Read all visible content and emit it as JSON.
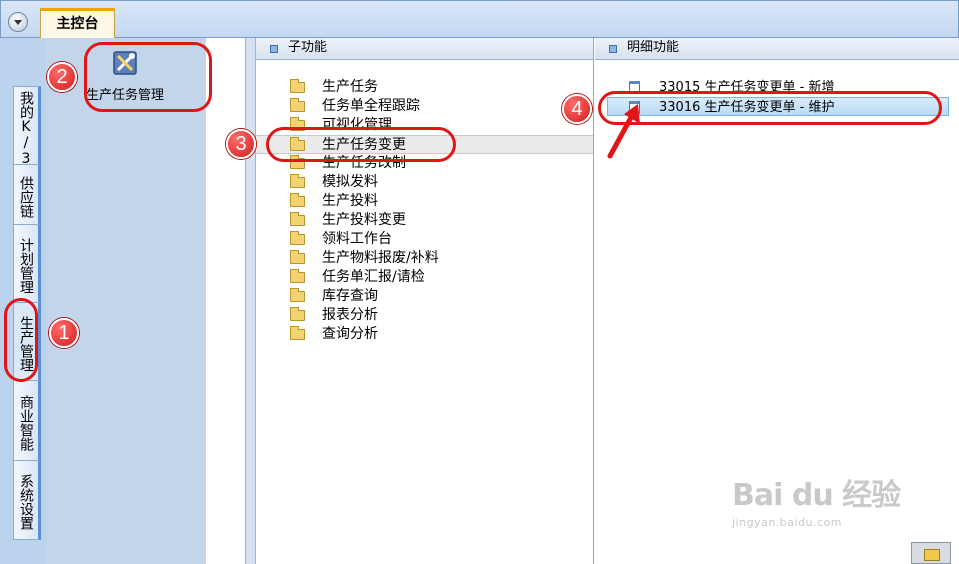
{
  "top_tab": {
    "label": "主控台"
  },
  "left_nav": {
    "tabs": [
      {
        "label": "我的K/3"
      },
      {
        "label": "供应链"
      },
      {
        "label": "计划管理"
      },
      {
        "label": "生产管理",
        "active": true
      },
      {
        "label": "商业智能"
      },
      {
        "label": "系统设置"
      }
    ]
  },
  "module": {
    "label": "生产任务管理"
  },
  "sub_panel": {
    "header": "子功能",
    "items": [
      "生产任务",
      "任务单全程跟踪",
      "可视化管理",
      "生产任务变更",
      "生产任务改制",
      "模拟发料",
      "生产投料",
      "生产投料变更",
      "领料工作台",
      "生产物料报废/补料",
      "任务单汇报/请检",
      "库存查询",
      "报表分析",
      "查询分析"
    ],
    "selected_index": 3
  },
  "detail_panel": {
    "header": "明细功能",
    "items": [
      "33015  生产任务变更单 - 新增",
      "33016  生产任务变更单 - 维护"
    ],
    "selected_index": 1
  },
  "callouts": [
    "1",
    "2",
    "3",
    "4"
  ],
  "watermark": {
    "logo": "Bai du 经验",
    "url": "jingyan.baidu.com"
  },
  "colors": {
    "highlight": "#e01616",
    "nav_bg": "#bcd3ee",
    "folder": "#f3d271"
  },
  "icons": [
    "dropdown-icon",
    "tools-icon",
    "folder-icon",
    "document-icon",
    "mail-icon"
  ]
}
